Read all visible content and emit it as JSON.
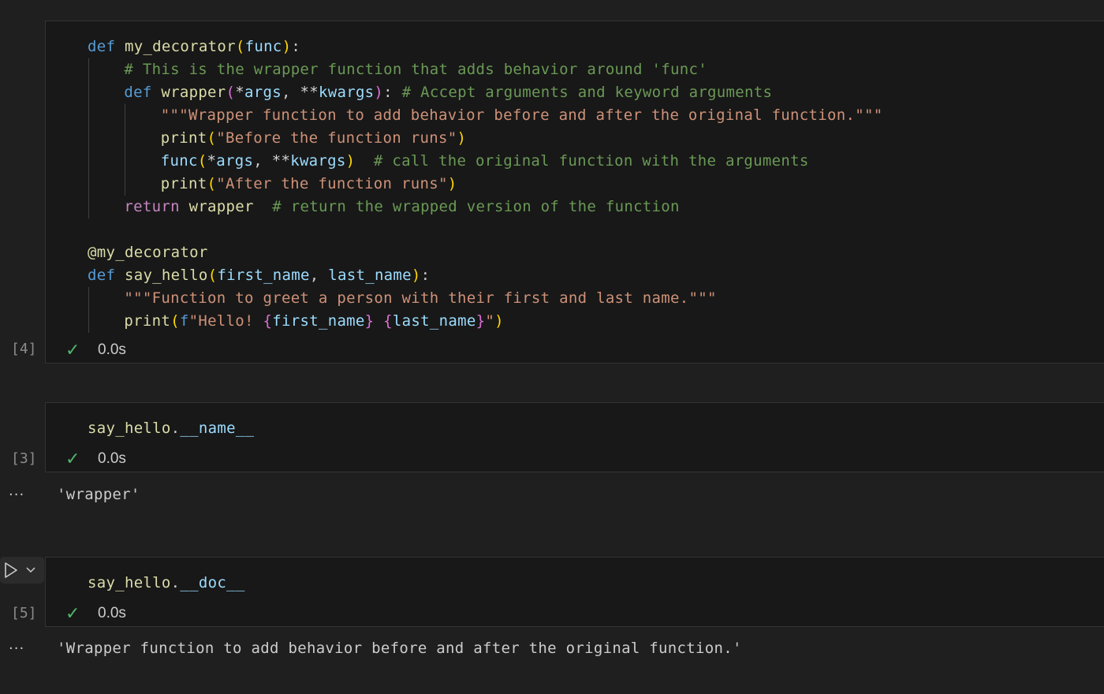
{
  "cells": [
    {
      "execution_count": "[4]",
      "status_icon": "check-icon",
      "duration": "0.0s",
      "code_lines": [
        {
          "indent": 0,
          "guides": 0,
          "tokens": [
            {
              "t": "def",
              "c": "kw"
            },
            {
              "t": " ",
              "c": "pu"
            },
            {
              "t": "my_decorator",
              "c": "fn"
            },
            {
              "t": "(",
              "c": "b1"
            },
            {
              "t": "func",
              "c": "pm"
            },
            {
              "t": ")",
              "c": "b1"
            },
            {
              "t": ":",
              "c": "pu"
            }
          ]
        },
        {
          "indent": 4,
          "guides": 1,
          "tokens": [
            {
              "t": "# This is the wrapper function that adds behavior around 'func'",
              "c": "cm"
            }
          ]
        },
        {
          "indent": 4,
          "guides": 1,
          "tokens": [
            {
              "t": "def",
              "c": "kw"
            },
            {
              "t": " ",
              "c": "pu"
            },
            {
              "t": "wrapper",
              "c": "fn"
            },
            {
              "t": "(",
              "c": "b2"
            },
            {
              "t": "*",
              "c": "op"
            },
            {
              "t": "args",
              "c": "pm"
            },
            {
              "t": ", ",
              "c": "pu"
            },
            {
              "t": "**",
              "c": "op"
            },
            {
              "t": "kwargs",
              "c": "pm"
            },
            {
              "t": ")",
              "c": "b2"
            },
            {
              "t": ": ",
              "c": "pu"
            },
            {
              "t": "# Accept arguments and keyword arguments",
              "c": "cm"
            }
          ]
        },
        {
          "indent": 8,
          "guides": 2,
          "tokens": [
            {
              "t": "\"\"\"Wrapper function to add behavior before and after the original function.\"\"\"",
              "c": "st"
            }
          ]
        },
        {
          "indent": 8,
          "guides": 2,
          "tokens": [
            {
              "t": "print",
              "c": "fn"
            },
            {
              "t": "(",
              "c": "b1"
            },
            {
              "t": "\"Before the function runs\"",
              "c": "st"
            },
            {
              "t": ")",
              "c": "b1"
            }
          ]
        },
        {
          "indent": 8,
          "guides": 2,
          "tokens": [
            {
              "t": "func",
              "c": "pm"
            },
            {
              "t": "(",
              "c": "b1"
            },
            {
              "t": "*",
              "c": "op"
            },
            {
              "t": "args",
              "c": "pm"
            },
            {
              "t": ", ",
              "c": "pu"
            },
            {
              "t": "**",
              "c": "op"
            },
            {
              "t": "kwargs",
              "c": "pm"
            },
            {
              "t": ")",
              "c": "b1"
            },
            {
              "t": "  ",
              "c": "pu"
            },
            {
              "t": "# call the original function with the arguments",
              "c": "cm"
            }
          ]
        },
        {
          "indent": 8,
          "guides": 2,
          "tokens": [
            {
              "t": "print",
              "c": "fn"
            },
            {
              "t": "(",
              "c": "b1"
            },
            {
              "t": "\"After the function runs\"",
              "c": "st"
            },
            {
              "t": ")",
              "c": "b1"
            }
          ]
        },
        {
          "indent": 4,
          "guides": 1,
          "tokens": [
            {
              "t": "return",
              "c": "ctl"
            },
            {
              "t": " ",
              "c": "pu"
            },
            {
              "t": "wrapper",
              "c": "fn"
            },
            {
              "t": "  ",
              "c": "pu"
            },
            {
              "t": "# return the wrapped version of the function",
              "c": "cm"
            }
          ]
        },
        {
          "indent": 0,
          "guides": 0,
          "tokens": []
        },
        {
          "indent": 0,
          "guides": 0,
          "tokens": [
            {
              "t": "@my_decorator",
              "c": "fn"
            }
          ]
        },
        {
          "indent": 0,
          "guides": 0,
          "tokens": [
            {
              "t": "def",
              "c": "kw"
            },
            {
              "t": " ",
              "c": "pu"
            },
            {
              "t": "say_hello",
              "c": "fn"
            },
            {
              "t": "(",
              "c": "b1"
            },
            {
              "t": "first_name",
              "c": "pm"
            },
            {
              "t": ", ",
              "c": "pu"
            },
            {
              "t": "last_name",
              "c": "pm"
            },
            {
              "t": ")",
              "c": "b1"
            },
            {
              "t": ":",
              "c": "pu"
            }
          ]
        },
        {
          "indent": 4,
          "guides": 1,
          "tokens": [
            {
              "t": "\"\"\"Function to greet a person with their first and last name.\"\"\"",
              "c": "st"
            }
          ]
        },
        {
          "indent": 4,
          "guides": 1,
          "tokens": [
            {
              "t": "print",
              "c": "fn"
            },
            {
              "t": "(",
              "c": "b1"
            },
            {
              "t": "f",
              "c": "kw"
            },
            {
              "t": "\"Hello! ",
              "c": "st"
            },
            {
              "t": "{",
              "c": "b2"
            },
            {
              "t": "first_name",
              "c": "pm"
            },
            {
              "t": "}",
              "c": "b2"
            },
            {
              "t": " ",
              "c": "st"
            },
            {
              "t": "{",
              "c": "b2"
            },
            {
              "t": "last_name",
              "c": "pm"
            },
            {
              "t": "}",
              "c": "b2"
            },
            {
              "t": "\"",
              "c": "st"
            },
            {
              "t": ")",
              "c": "b1"
            }
          ]
        }
      ],
      "output": null
    },
    {
      "execution_count": "[3]",
      "status_icon": "check-icon",
      "duration": "0.0s",
      "code_lines": [
        {
          "indent": 0,
          "guides": 0,
          "tokens": [
            {
              "t": "say_hello",
              "c": "fn"
            },
            {
              "t": ".",
              "c": "pu"
            },
            {
              "t": "__name__",
              "c": "pm"
            }
          ]
        }
      ],
      "output": {
        "ellipsis": "···",
        "text": "'wrapper'"
      }
    },
    {
      "execution_count": "[5]",
      "status_icon": "check-icon",
      "duration": "0.0s",
      "code_lines": [
        {
          "indent": 0,
          "guides": 0,
          "tokens": [
            {
              "t": "say_hello",
              "c": "fn"
            },
            {
              "t": ".",
              "c": "pu"
            },
            {
              "t": "__doc__",
              "c": "pm"
            }
          ]
        }
      ],
      "output": {
        "ellipsis": "···",
        "text": "'Wrapper function to add behavior before and after the original function.'"
      }
    }
  ],
  "run_toolbar": {
    "run_icon": "play-icon",
    "menu_icon": "chevron-down-icon"
  },
  "colors": {
    "background": "#1f1f1f",
    "cell_background": "#181818",
    "success": "#4fb56a"
  }
}
